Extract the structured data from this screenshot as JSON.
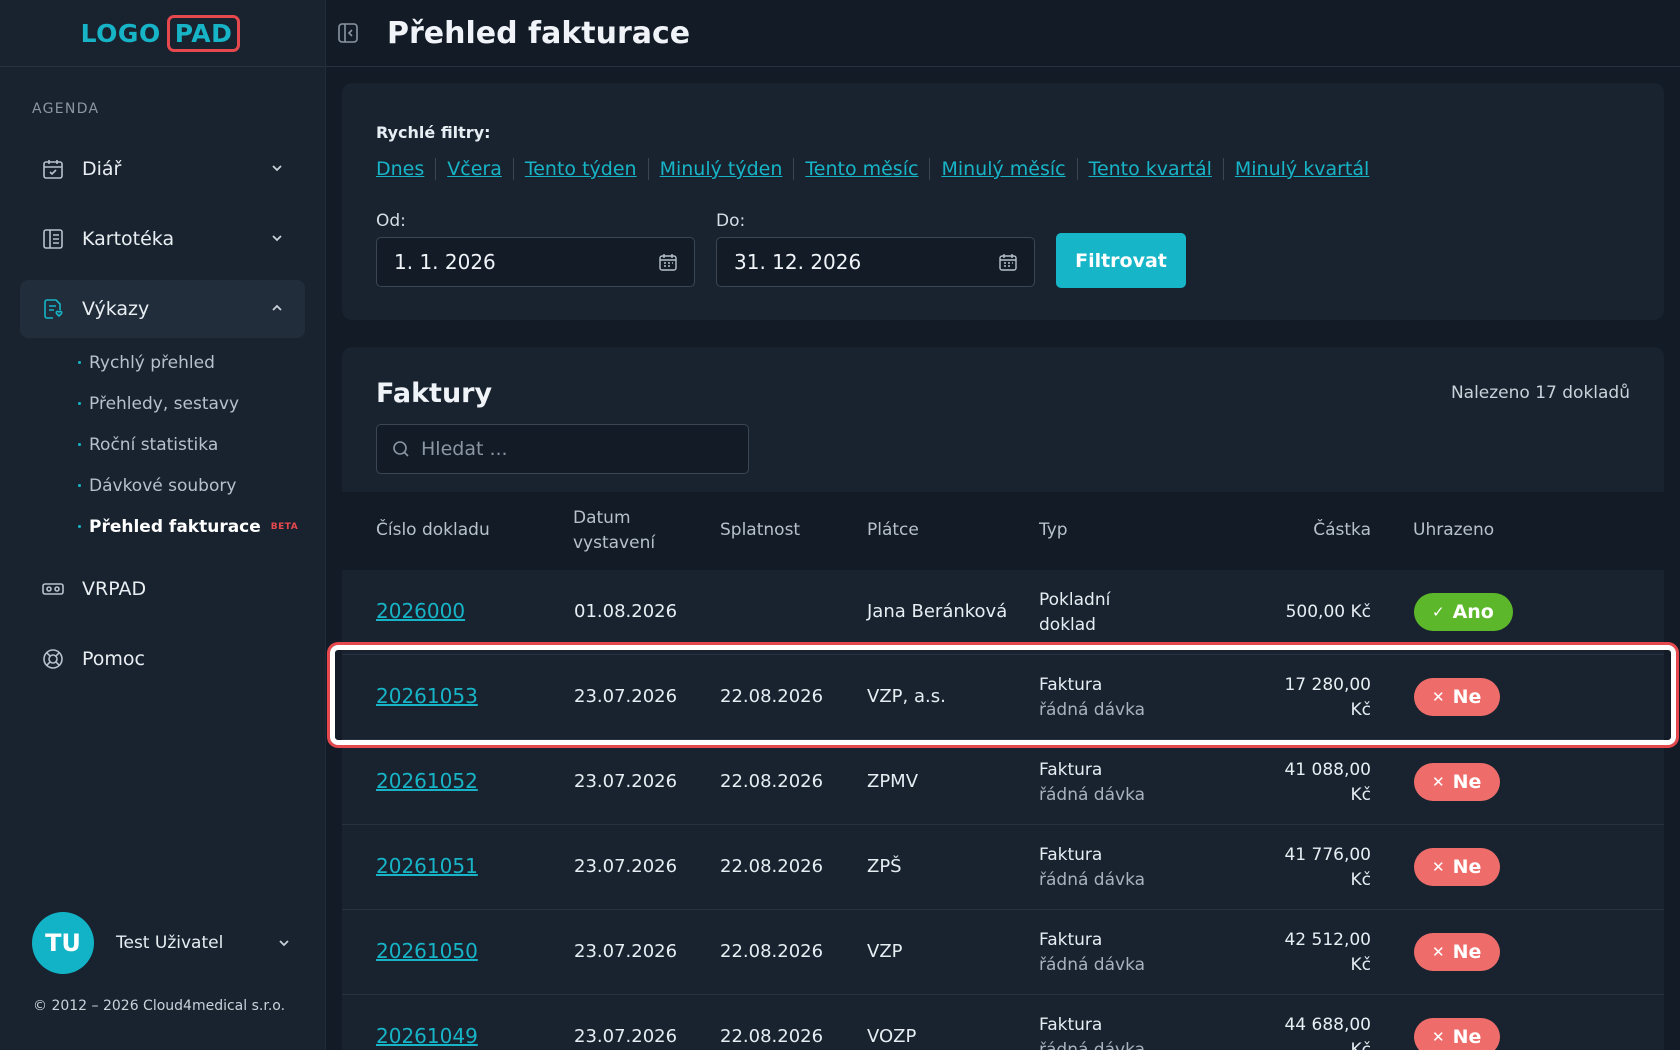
{
  "logo": {
    "left": "LOGO",
    "right": "PAD"
  },
  "sidebar": {
    "section_label": "AGENDA",
    "items": [
      {
        "label": "Diář",
        "icon": "calendar-icon",
        "expanded": false
      },
      {
        "label": "Kartotéka",
        "icon": "card-file-icon",
        "expanded": false
      },
      {
        "label": "Výkazy",
        "icon": "report-icon",
        "expanded": true
      },
      {
        "label": "VRPAD",
        "icon": "vr-headset-icon"
      },
      {
        "label": "Pomoc",
        "icon": "lifebuoy-icon"
      }
    ],
    "sub_items": [
      {
        "label": "Rychlý přehled"
      },
      {
        "label": "Přehledy, sestavy"
      },
      {
        "label": "Roční statistika"
      },
      {
        "label": "Dávkové soubory"
      },
      {
        "label": "Přehled fakturace",
        "badge": "BETA"
      }
    ]
  },
  "user": {
    "initials": "TU",
    "name": "Test Uživatel"
  },
  "copyright": "© 2012 – 2026 Cloud4medical s.r.o.",
  "header": {
    "title": "Přehled fakturace"
  },
  "filters": {
    "quick_label": "Rychlé filtry:",
    "quick": [
      "Dnes",
      "Včera",
      "Tento týden",
      "Minulý týden",
      "Tento měsíc",
      "Minulý měsíc",
      "Tento kvartál",
      "Minulý kvartál"
    ],
    "from_label": "Od:",
    "from_value": "1. 1. 2026",
    "to_label": "Do:",
    "to_value": "31. 12. 2026",
    "button": "Filtrovat"
  },
  "invoices": {
    "title": "Faktury",
    "count": "Nalezeno 17 dokladů",
    "search_placeholder": "Hledat ...",
    "columns": {
      "number": "Číslo dokladu",
      "issued_1": "Datum",
      "issued_2": "vystavení",
      "due": "Splatnost",
      "payer": "Plátce",
      "type": "Typ",
      "amount": "Částka",
      "paid": "Uhrazeno"
    },
    "rows": [
      {
        "number": "2026000",
        "issued": "01.08.2026",
        "due": "",
        "payer": "Jana Beránková",
        "type_1": "Pokladní",
        "type_2": "doklad",
        "amount_1": "500,00 Kč",
        "amount_2": "",
        "paid": "Ano",
        "paid_status": "yes"
      },
      {
        "number": "20261053",
        "issued": "23.07.2026",
        "due": "22.08.2026",
        "payer": "VZP, a.s.",
        "type_1": "Faktura",
        "type_2": "řádná dávka",
        "amount_1": "17 280,00",
        "amount_2": "Kč",
        "paid": "Ne",
        "paid_status": "no",
        "highlighted": true
      },
      {
        "number": "20261052",
        "issued": "23.07.2026",
        "due": "22.08.2026",
        "payer": "ZPMV",
        "type_1": "Faktura",
        "type_2": "řádná dávka",
        "amount_1": "41 088,00",
        "amount_2": "Kč",
        "paid": "Ne",
        "paid_status": "no"
      },
      {
        "number": "20261051",
        "issued": "23.07.2026",
        "due": "22.08.2026",
        "payer": "ZPŠ",
        "type_1": "Faktura",
        "type_2": "řádná dávka",
        "amount_1": "41 776,00",
        "amount_2": "Kč",
        "paid": "Ne",
        "paid_status": "no"
      },
      {
        "number": "20261050",
        "issued": "23.07.2026",
        "due": "22.08.2026",
        "payer": "VZP",
        "type_1": "Faktura",
        "type_2": "řádná dávka",
        "amount_1": "42 512,00",
        "amount_2": "Kč",
        "paid": "Ne",
        "paid_status": "no"
      },
      {
        "number": "20261049",
        "issued": "23.07.2026",
        "due": "22.08.2026",
        "payer": "VOZP",
        "type_1": "Faktura",
        "type_2": "řádná dávka",
        "amount_1": "44 688,00",
        "amount_2": "Kč",
        "paid": "Ne",
        "paid_status": "no"
      }
    ]
  },
  "colors": {
    "accent": "#17b4c7",
    "paid_yes": "#5cb82a",
    "paid_no": "#ee6d6a",
    "highlight": "#e5484d"
  }
}
